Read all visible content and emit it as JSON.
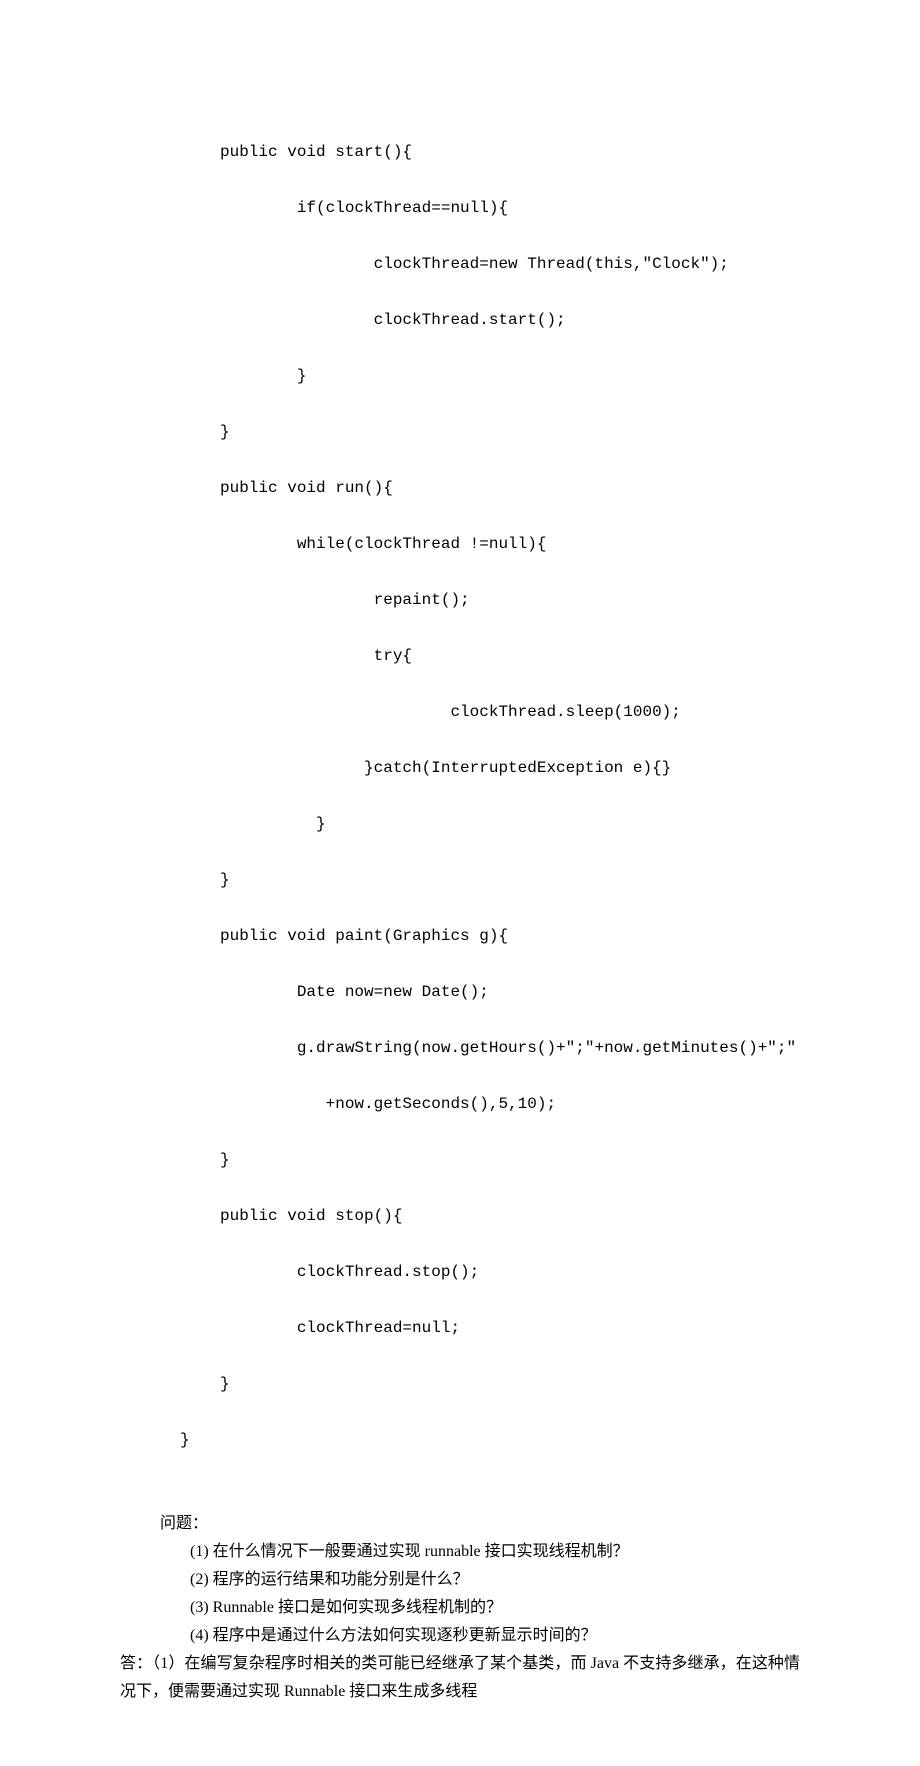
{
  "code": {
    "l01": "public void start(){",
    "l02": "        if(clockThread==null){",
    "l03": "                clockThread=new Thread(this,\"Clock\");",
    "l04": "                clockThread.start();",
    "l05": "        }",
    "l06": "}",
    "l07": "public void run(){",
    "l08": "        while(clockThread !=null){",
    "l09": "                repaint();",
    "l10": "                try{",
    "l11": "                        clockThread.sleep(1000);",
    "l12": "               }catch(InterruptedException e){}",
    "l13": "          }",
    "l14": "}",
    "l15": "public void paint(Graphics g){",
    "l16": "        Date now=new Date();",
    "l17": "        g.drawString(now.getHours()+\";\"+now.getMinutes()+\";\"",
    "l18": "           +now.getSeconds(),5,10);",
    "l19": "}",
    "l20": "public void stop(){",
    "l21": "        clockThread.stop();",
    "l22": "        clockThread=null;",
    "l23": "}",
    "l24": "}"
  },
  "questions": {
    "heading": "问题：",
    "q1": "(1) 在什么情况下一般要通过实现 runnable 接口实现线程机制？",
    "q2": "(2) 程序的运行结果和功能分别是什么？",
    "q3": "(3) Runnable 接口是如何实现多线程机制的？",
    "q4": "(4) 程序中是通过什么方法如何实现逐秒更新显示时间的？"
  },
  "answer": {
    "text": "答：（1）在编写复杂程序时相关的类可能已经继承了某个基类，而 Java 不支持多继承，在这种情况下，便需要通过实现 Runnable 接口来生成多线程"
  }
}
